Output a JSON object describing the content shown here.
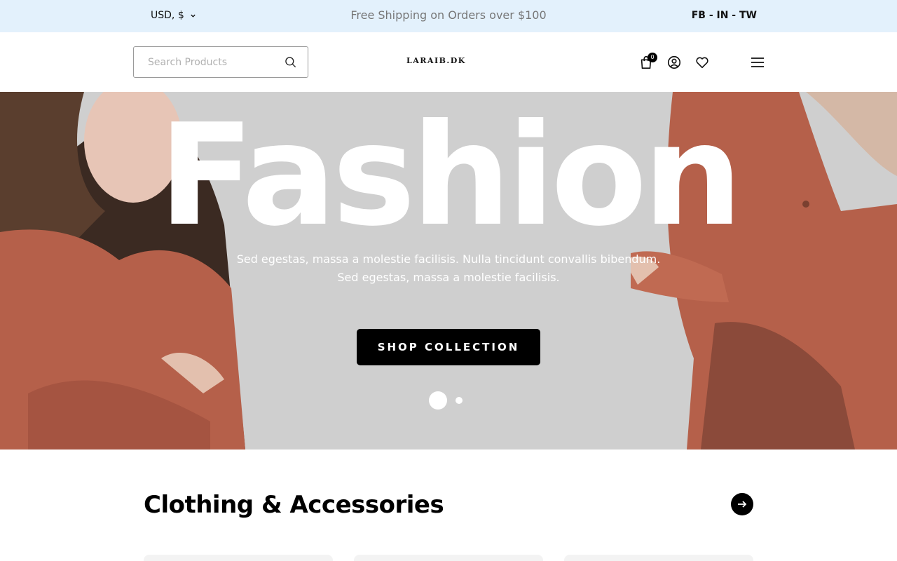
{
  "topbar": {
    "currency": "USD, $",
    "shipping_text": "Free Shipping on Orders over $100",
    "social_text": "FB - IN - TW"
  },
  "header": {
    "search_placeholder": "Search Products",
    "logo_text": "LARAIB.DK",
    "cart_count": "0"
  },
  "hero": {
    "title": "Fashion",
    "subtitle_line1": "Sed egestas, massa a molestie facilisis. Nulla tincidunt convallis bibendum.",
    "subtitle_line2": "Sed egestas, massa a molestie facilisis.",
    "button_label": "SHOP COLLECTION",
    "slides_count": 2,
    "active_slide": 1
  },
  "section": {
    "title": "Clothing & Accessories"
  },
  "icons": {
    "currency_dropdown": "chevron-down-icon",
    "search": "search-icon",
    "cart": "shopping-bag-icon",
    "account": "user-icon",
    "wishlist": "heart-icon",
    "menu": "hamburger-menu-icon",
    "next": "arrow-right-icon"
  },
  "colors": {
    "topbar_bg": "#e3f1fc",
    "hero_bg": "#cfcfcf",
    "button_bg": "#000000",
    "accent_coat": "#b5604a"
  }
}
